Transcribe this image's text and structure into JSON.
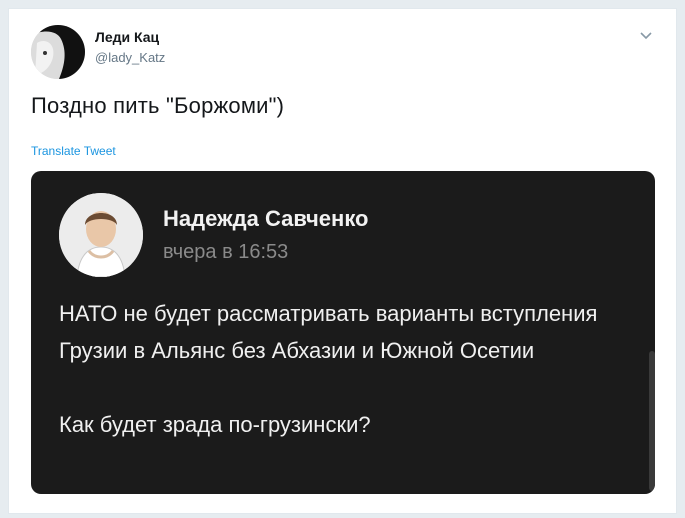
{
  "tweet": {
    "author_name": "Леди Кац",
    "author_handle": "@lady_Katz",
    "text": "Поздно пить \"Боржоми\")",
    "translate_label": "Translate Tweet"
  },
  "embedded_post": {
    "author_name": "Надежда Савченко",
    "timestamp": "вчера в 16:53",
    "paragraph_1": "НАТО не будет рассматривать варианты вступления Грузии в Альянс без Абхазии и Южной Осетии",
    "paragraph_2": "Как будет зрада по-грузински?"
  },
  "icons": {
    "menu": "chevron-down-icon"
  },
  "colors": {
    "link": "#1b95e0",
    "card_background": "#1b1b1b",
    "page_background": "#e6ecf0"
  }
}
